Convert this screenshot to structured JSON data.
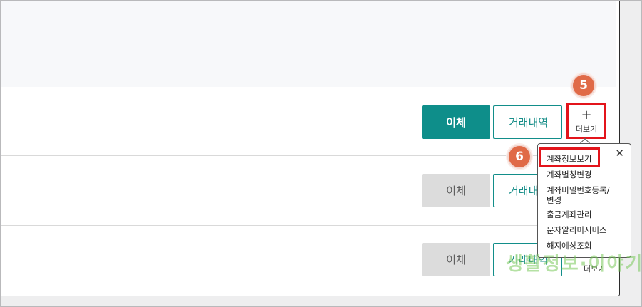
{
  "rows": [
    {
      "transfer_label": "이체",
      "history_label": "거래내역",
      "more_label": "더보기",
      "more_icon": "plus-icon",
      "state": "active"
    },
    {
      "transfer_label": "이체",
      "history_label": "거래내역",
      "state": "disabled"
    },
    {
      "transfer_label": "이체",
      "history_label": "거래내역",
      "more_label": "더보기",
      "state": "disabled"
    }
  ],
  "callouts": {
    "step_5": "5",
    "step_6": "6"
  },
  "dropdown": {
    "close_symbol": "✕",
    "items": [
      "계좌정보보기",
      "계좌별칭변경",
      "계좌비밀번호등록/\n변경",
      "출금계좌관리",
      "문자알리미서비스",
      "해지예상조회"
    ]
  },
  "watermark": "생활정보·이야기",
  "colors": {
    "accent": "#0e8e8a",
    "highlight": "#e3141b",
    "badge": "#e06a47",
    "disabled": "#dcdcdc"
  }
}
